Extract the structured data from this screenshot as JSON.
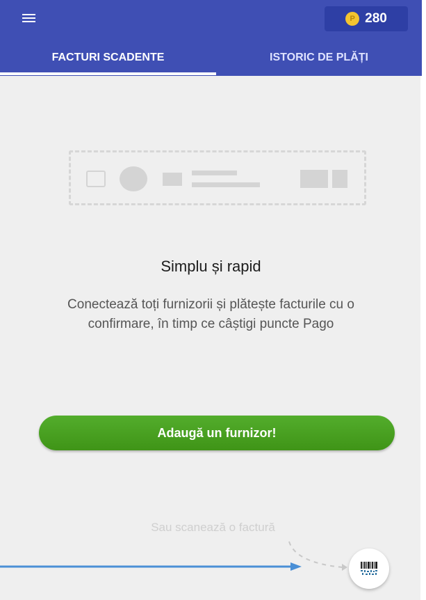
{
  "header": {
    "points": "280",
    "points_coin_glyph": "P"
  },
  "tabs": [
    {
      "label": "FACTURI SCADENTE",
      "active": true
    },
    {
      "label": "ISTORIC DE PLĂȚI",
      "active": false
    }
  ],
  "empty_state": {
    "title": "Simplu și rapid",
    "description": "Conectează toți furnizorii și plătește facturile cu o confirmare, în timp ce câștigi puncte Pago"
  },
  "primary_action": {
    "label": "Adaugă un furnizor!"
  },
  "scan": {
    "hint": "Sau scanează o factură",
    "icon": "barcode-scan-icon"
  },
  "colors": {
    "appbar": "#3f4fb4",
    "button_green": "#4aa323",
    "background": "#efefef",
    "annotation_arrow": "#4a8fd6"
  }
}
